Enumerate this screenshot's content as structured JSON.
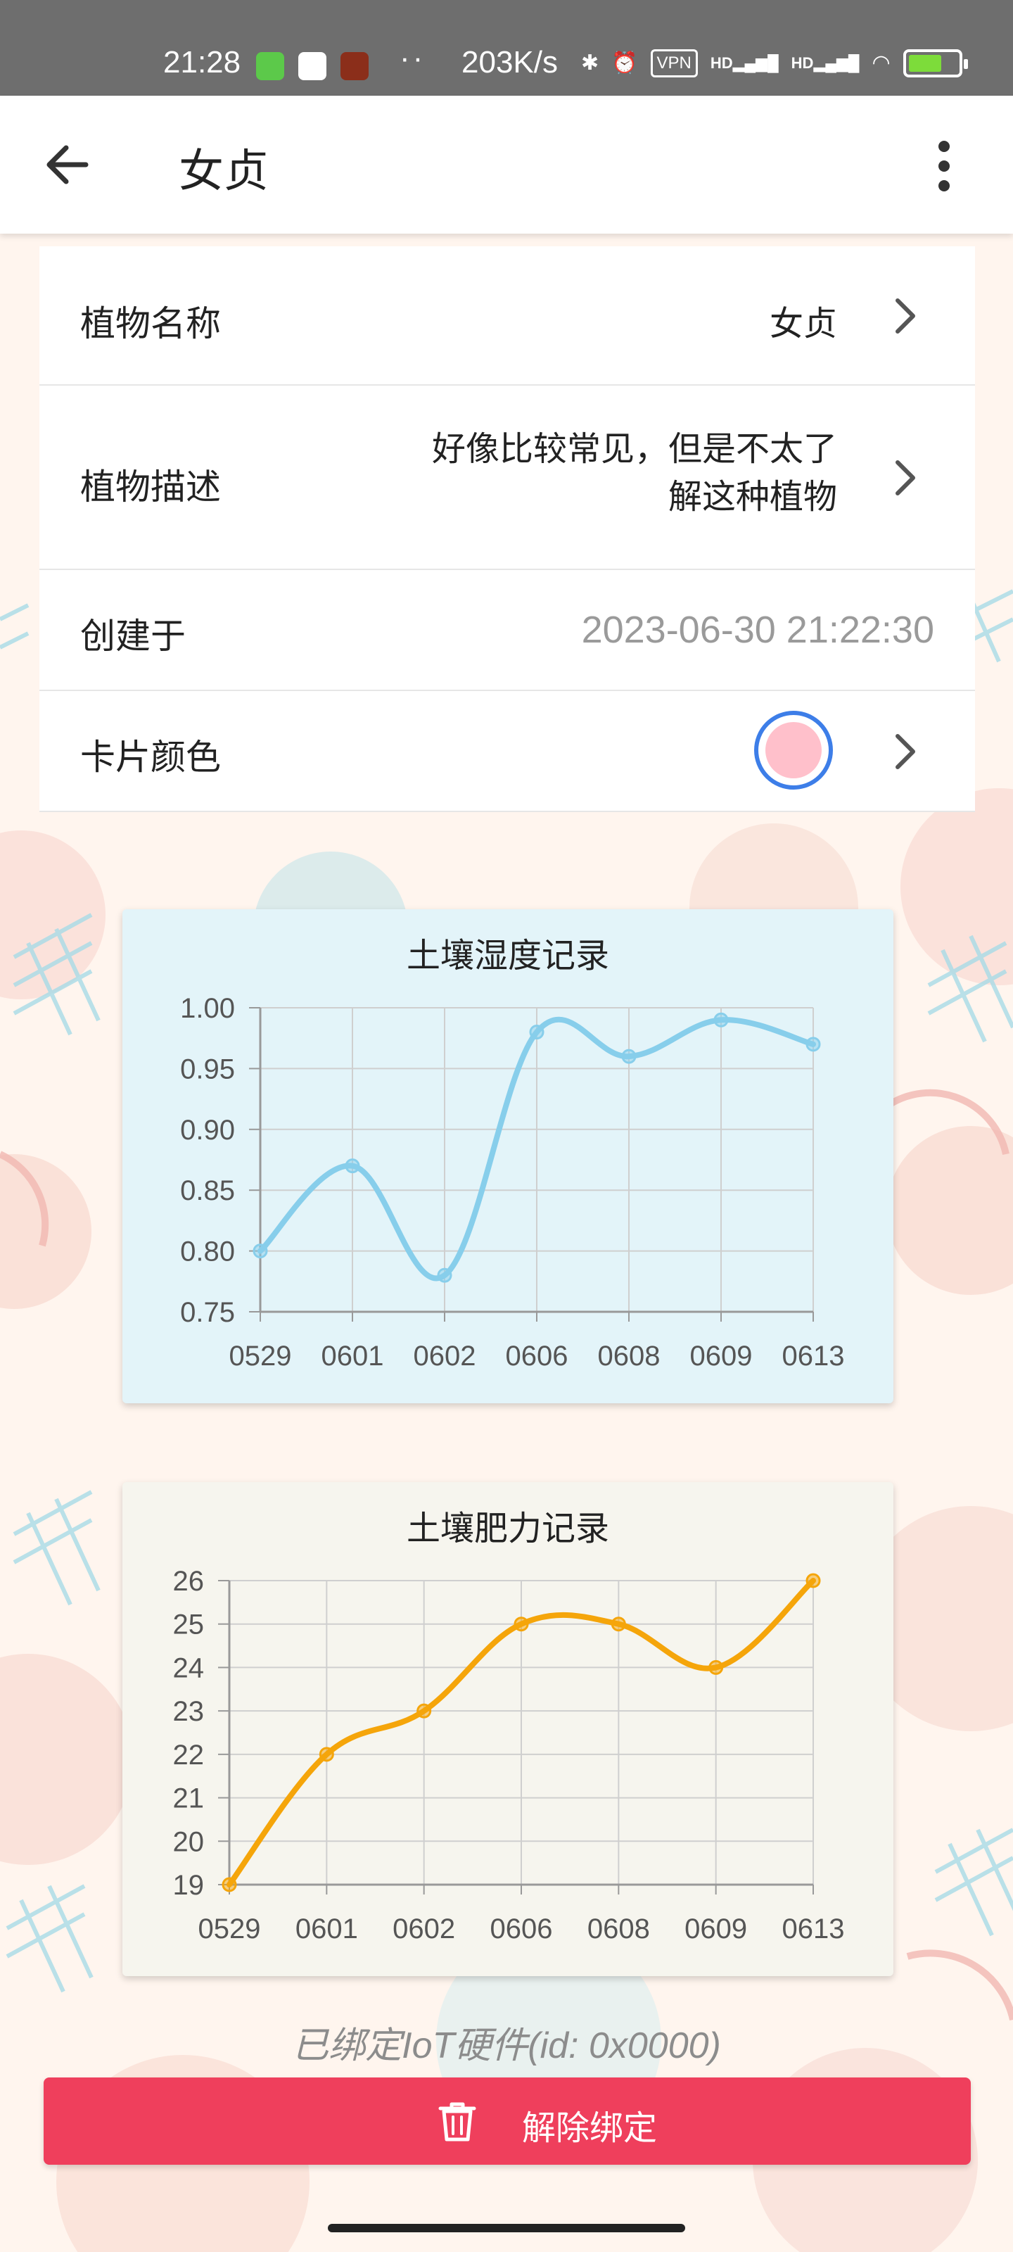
{
  "status_bar": {
    "time": "21:28",
    "dots": "··",
    "net_speed": "203K/s",
    "vpn": "VPN",
    "hd1": "HD",
    "hd2": "HD"
  },
  "app_bar": {
    "title": "女贞"
  },
  "settings": {
    "name_label": "植物名称",
    "name_value": "女贞",
    "desc_label": "植物描述",
    "desc_value": "好像比较常见，但是不太了解这种植物",
    "created_label": "创建于",
    "created_value": "2023-06-30 21:22:30",
    "color_label": "卡片颜色",
    "card_color": "#ffc0cb"
  },
  "chart_data": [
    {
      "type": "line",
      "title": "土壤湿度记录",
      "categories": [
        "0529",
        "0601",
        "0602",
        "0606",
        "0608",
        "0609",
        "0613"
      ],
      "series": [
        {
          "values": [
            0.8,
            0.87,
            0.78,
            0.98,
            0.96,
            0.99,
            0.97
          ]
        }
      ],
      "ylim": [
        0.75,
        1.0
      ],
      "yticks": [
        "0.75",
        "0.80",
        "0.85",
        "0.90",
        "0.95",
        "1.00"
      ],
      "color": "#87ceeb",
      "background": "#e3f4f9",
      "grid": true,
      "smooth": true
    },
    {
      "type": "line",
      "title": "土壤肥力记录",
      "categories": [
        "0529",
        "0601",
        "0602",
        "0606",
        "0608",
        "0609",
        "0613"
      ],
      "series": [
        {
          "values": [
            19,
            22,
            23,
            25,
            25,
            24,
            26
          ]
        }
      ],
      "ylim": [
        19,
        26
      ],
      "yticks": [
        "19",
        "20",
        "21",
        "22",
        "23",
        "24",
        "25",
        "26"
      ],
      "color": "#f5a50a",
      "background": "#f6f5ee",
      "grid": true,
      "smooth": true
    }
  ],
  "iot_text": "已绑定IoT硬件(id: 0x0000)",
  "unbind_label": "解除绑定",
  "colors": {
    "danger": "#ef3f5c",
    "swatch_ring": "#3d7ee8"
  }
}
